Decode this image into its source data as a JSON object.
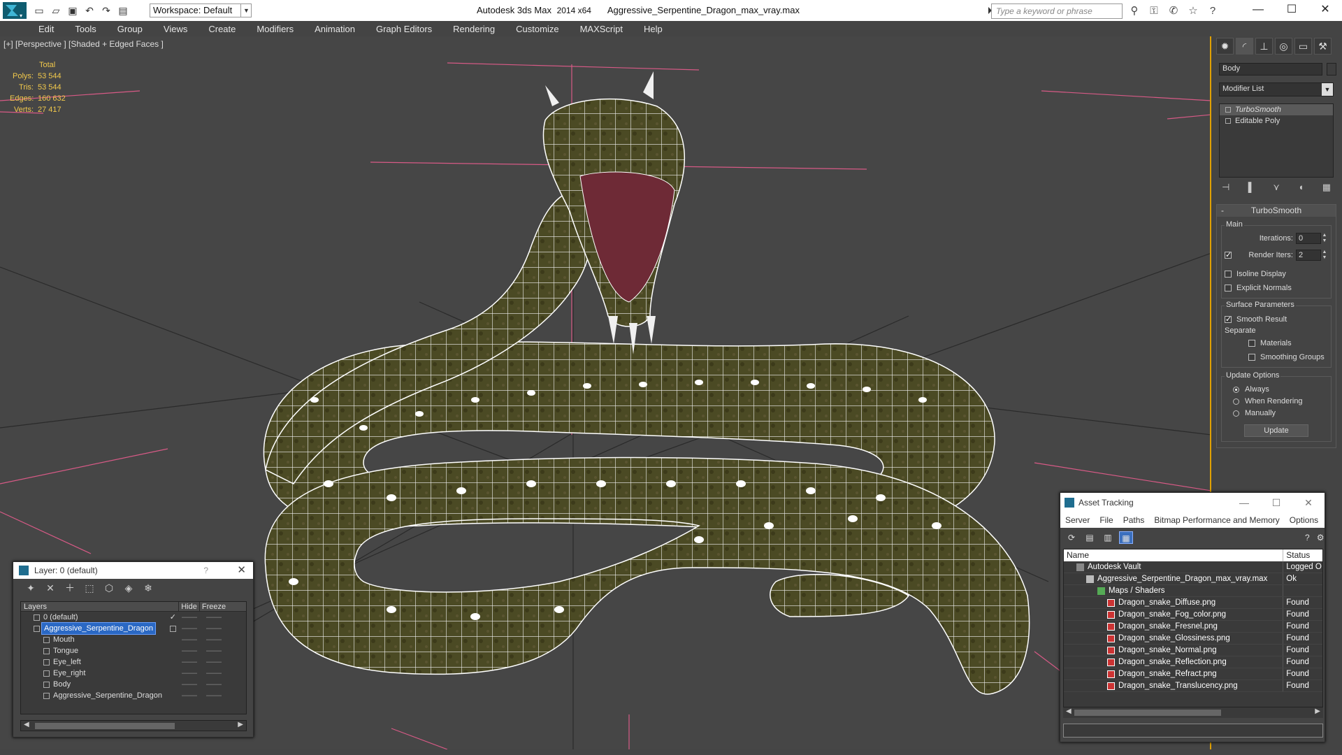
{
  "titlebar": {
    "workspace": "Workspace: Default",
    "app": "Autodesk 3ds Max",
    "version": "2014 x64",
    "file": "Aggressive_Serpentine_Dragon_max_vray.max",
    "search_placeholder": "Type a keyword or phrase",
    "quick_access_icons": [
      "new-icon",
      "open-icon",
      "save-icon",
      "undo-icon",
      "redo-icon",
      "project-icon"
    ],
    "help_icons": [
      "binoculars-icon",
      "subscription-icon",
      "communication-icon",
      "favorites-icon",
      "help-icon"
    ],
    "window_controls": {
      "minimize": "—",
      "maximize": "☐",
      "close": "✕"
    }
  },
  "menu": [
    "Edit",
    "Tools",
    "Group",
    "Views",
    "Create",
    "Modifiers",
    "Animation",
    "Graph Editors",
    "Rendering",
    "Customize",
    "MAXScript",
    "Help"
  ],
  "viewport": {
    "label": "[+] [Perspective ] [Shaded + Edged Faces ]",
    "stats": {
      "header": "Total",
      "rows": [
        {
          "k": "Polys:",
          "v": "53 544"
        },
        {
          "k": "Tris:",
          "v": "53 544"
        },
        {
          "k": "Edges:",
          "v": "160 632"
        },
        {
          "k": "Verts:",
          "v": "27 417"
        }
      ]
    },
    "colors": {
      "background": "#464646",
      "grid": "#222222",
      "gizmo": "#e05a8a",
      "stats": "#f2c94c",
      "mesh": "#4b4a24",
      "wire": "#ffffff"
    }
  },
  "command_panel": {
    "object_name": "Body",
    "modifier_list": "Modifier List",
    "stack": [
      {
        "label": "TurboSmooth",
        "selected": true
      },
      {
        "label": "Editable Poly",
        "selected": false
      }
    ],
    "rollout_title": "TurboSmooth",
    "main_group": "Main",
    "iterations_label": "Iterations:",
    "iterations_value": "0",
    "render_iters_label": "Render Iters:",
    "render_iters_value": "2",
    "isoline": "Isoline Display",
    "explicit_normals": "Explicit Normals",
    "surface_group": "Surface Parameters",
    "smooth_result": "Smooth Result",
    "separate": "Separate",
    "materials": "Materials",
    "smoothing_groups": "Smoothing Groups",
    "update_group": "Update Options",
    "always": "Always",
    "when_rendering": "When Rendering",
    "manually": "Manually",
    "update_button": "Update"
  },
  "layer_dialog": {
    "title": "Layer: 0 (default)",
    "help": "?",
    "columns": {
      "layers": "Layers",
      "hide": "Hide",
      "freeze": "Freeze"
    },
    "rows": [
      {
        "name": "0 (default)",
        "indent": 1,
        "selected": false
      },
      {
        "name": "Aggressive_Serpentine_Dragon",
        "indent": 1,
        "selected": true
      },
      {
        "name": "Mouth",
        "indent": 2,
        "selected": false
      },
      {
        "name": "Tongue",
        "indent": 2,
        "selected": false
      },
      {
        "name": "Eye_left",
        "indent": 2,
        "selected": false
      },
      {
        "name": "Eye_right",
        "indent": 2,
        "selected": false
      },
      {
        "name": "Body",
        "indent": 2,
        "selected": false
      },
      {
        "name": "Aggressive_Serpentine_Dragon",
        "indent": 2,
        "selected": false
      }
    ],
    "hide_mark": "——",
    "freeze_mark": "——"
  },
  "asset_dialog": {
    "title": "Asset Tracking",
    "menu": [
      "Server",
      "File",
      "Paths",
      "Bitmap Performance and Memory",
      "Options"
    ],
    "columns": {
      "name": "Name",
      "status": "Status"
    },
    "rows": [
      {
        "name": "Autodesk Vault",
        "status": "Logged O",
        "indent": 0,
        "icon": "vault"
      },
      {
        "name": "Aggressive_Serpentine_Dragon_max_vray.max",
        "status": "Ok",
        "indent": 1,
        "icon": "max"
      },
      {
        "name": "Maps / Shaders",
        "status": "",
        "indent": 2,
        "icon": "maps"
      },
      {
        "name": "Dragon_snake_Diffuse.png",
        "status": "Found",
        "indent": 3,
        "icon": "png"
      },
      {
        "name": "Dragon_snake_Fog_color.png",
        "status": "Found",
        "indent": 3,
        "icon": "png"
      },
      {
        "name": "Dragon_snake_Fresnel.png",
        "status": "Found",
        "indent": 3,
        "icon": "png"
      },
      {
        "name": "Dragon_snake_Glossiness.png",
        "status": "Found",
        "indent": 3,
        "icon": "png"
      },
      {
        "name": "Dragon_snake_Normal.png",
        "status": "Found",
        "indent": 3,
        "icon": "png"
      },
      {
        "name": "Dragon_snake_Reflection.png",
        "status": "Found",
        "indent": 3,
        "icon": "png"
      },
      {
        "name": "Dragon_snake_Refract.png",
        "status": "Found",
        "indent": 3,
        "icon": "png"
      },
      {
        "name": "Dragon_snake_Translucency.png",
        "status": "Found",
        "indent": 3,
        "icon": "png"
      }
    ]
  }
}
